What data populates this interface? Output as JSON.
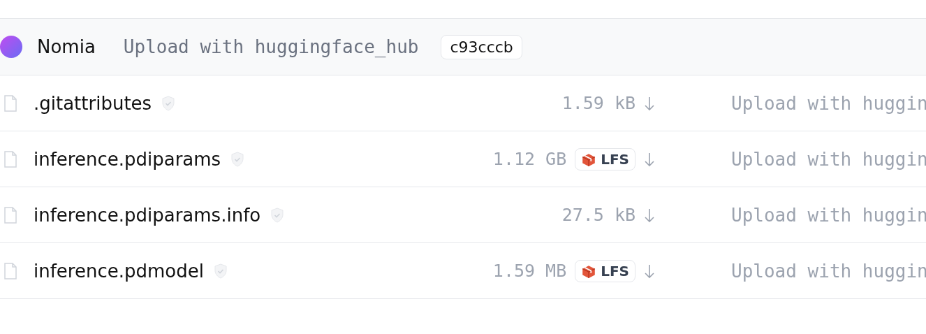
{
  "last_commit": {
    "author": "Nomia",
    "message": "Upload with huggingface_hub",
    "hash": "c93cccb"
  },
  "files": [
    {
      "name": ".gitattributes",
      "size": "1.59 kB",
      "lfs": false,
      "message": "Upload with huggin"
    },
    {
      "name": "inference.pdiparams",
      "size": "1.12 GB",
      "lfs": true,
      "lfs_label": "LFS",
      "message": "Upload with huggin"
    },
    {
      "name": "inference.pdiparams.info",
      "size": "27.5 kB",
      "lfs": false,
      "message": "Upload with huggin"
    },
    {
      "name": "inference.pdmodel",
      "size": "1.59 MB",
      "lfs": true,
      "lfs_label": "LFS",
      "message": "Upload with huggin"
    }
  ]
}
